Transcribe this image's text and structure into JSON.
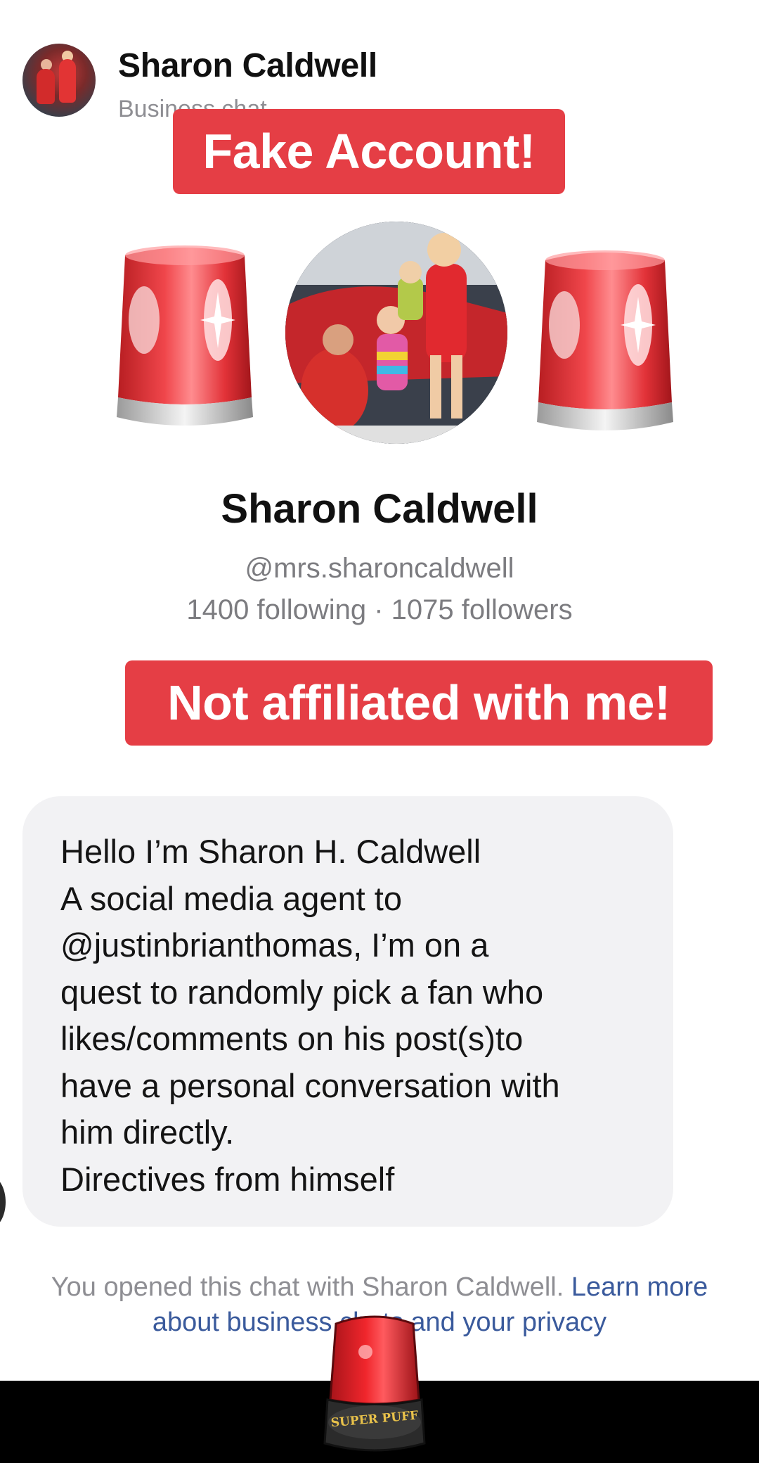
{
  "header": {
    "name": "Sharon Caldwell",
    "subtitle": "Business chat"
  },
  "banners": {
    "fake_account": "Fake Account!",
    "not_affiliated": "Not affiliated with me!"
  },
  "profile": {
    "name": "Sharon Caldwell",
    "handle": "@mrs.sharoncaldwell",
    "stats": "1400 following · 1075 followers"
  },
  "message": {
    "lines": [
      "Hello I’m Sharon H. Caldwell",
      "A social media agent to",
      "@justinbrianthomas, I’m on a",
      "quest to randomly pick a fan who",
      "likes/comments on his post(s)to",
      "have a personal conversation with",
      "him directly.",
      "Directives from  himself"
    ]
  },
  "footer": {
    "prefix": "You opened this chat with Sharon Caldwell. ",
    "link": "Learn more about business chats and your privacy"
  },
  "badge": {
    "label": "SUPER PUFF"
  },
  "colors": {
    "banner_red": "#e53e45",
    "link_blue": "#3a5a9c",
    "muted_gray": "#8e8e93"
  }
}
